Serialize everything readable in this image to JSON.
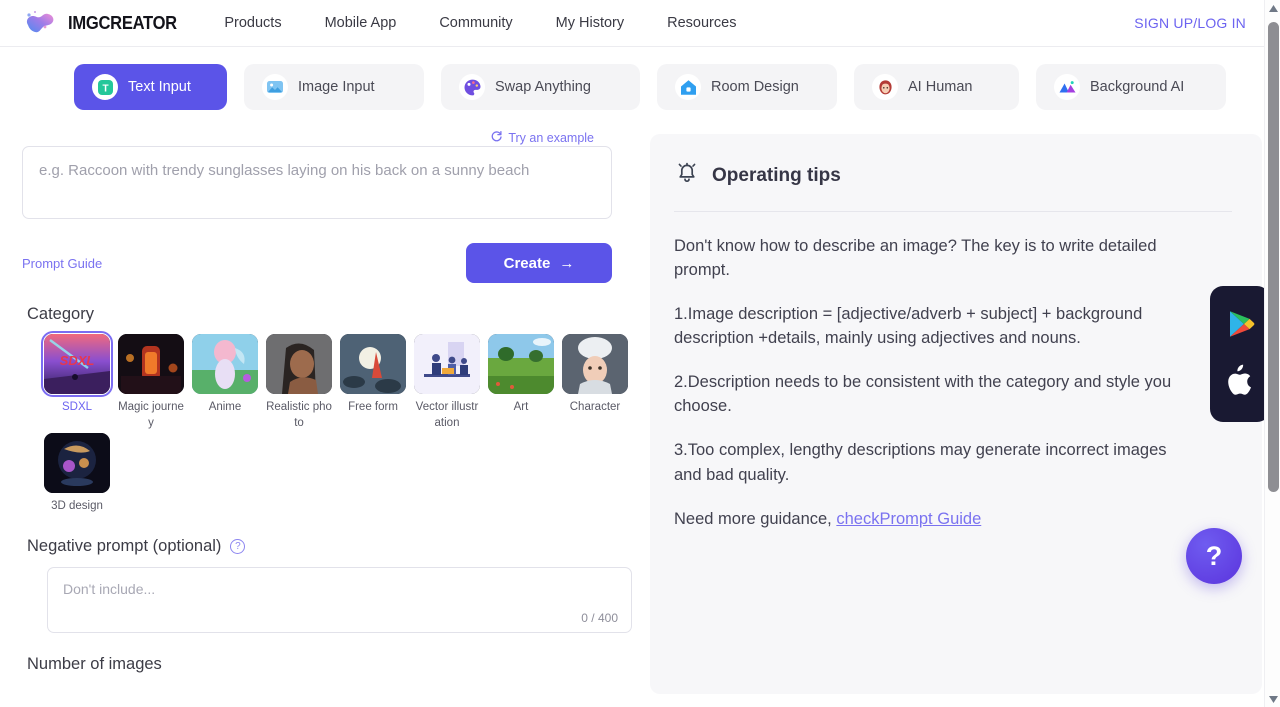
{
  "header": {
    "brand": "IMGCREATOR",
    "logo_colors": {
      "from": "#5b8dea",
      "to": "#e98fd8"
    },
    "nav": [
      {
        "label": "Products"
      },
      {
        "label": "Mobile App"
      },
      {
        "label": "Community"
      },
      {
        "label": "My History"
      },
      {
        "label": "Resources"
      }
    ],
    "auth_label": "SIGN UP/LOG IN",
    "auth_color": "#6c63f0"
  },
  "tabs": [
    {
      "label": "Text Input",
      "icon": "text-t-icon",
      "active": true
    },
    {
      "label": "Image Input",
      "icon": "picture-icon",
      "active": false
    },
    {
      "label": "Swap Anything",
      "icon": "palette-icon",
      "active": false
    },
    {
      "label": "Room Design",
      "icon": "house-icon",
      "active": false
    },
    {
      "label": "AI Human",
      "icon": "woman-face-icon",
      "active": false
    },
    {
      "label": "Background AI",
      "icon": "mountain-icon",
      "active": false
    }
  ],
  "prompt": {
    "try_example_label": "Try an example",
    "try_example_icon": "refresh-icon",
    "placeholder": "e.g. Raccoon with trendy sunglasses laying on his back on a sunny beach",
    "value": "",
    "guide_label": "Prompt Guide",
    "create_label": "Create",
    "create_arrow": "→"
  },
  "category": {
    "title": "Category",
    "items": [
      {
        "label": "SDXL",
        "selected": true
      },
      {
        "label": "Magic journey",
        "selected": false
      },
      {
        "label": "Anime",
        "selected": false
      },
      {
        "label": "Realistic photo",
        "selected": false
      },
      {
        "label": "Free form",
        "selected": false
      },
      {
        "label": "Vector illustration",
        "selected": false
      },
      {
        "label": "Art",
        "selected": false
      },
      {
        "label": "Character",
        "selected": false
      },
      {
        "label": "3D design",
        "selected": false
      }
    ]
  },
  "negative": {
    "title": "Negative prompt (optional)",
    "help_icon": "question-circle-icon",
    "placeholder": "Don't include...",
    "value": "",
    "counter": "0 / 400"
  },
  "number_of_images": {
    "title": "Number of images"
  },
  "tips": {
    "icon": "bell-icon",
    "title": "Operating tips",
    "paragraphs": [
      "Don't know how to describe an image? The key is to write detailed prompt.",
      "1.Image description = [adjective/adverb + subject] + background description +details, mainly using adjectives and nouns.",
      "2.Description needs to be consistent with the category and style you choose.",
      "3.Too complex, lengthy descriptions may generate incorrect images and bad quality."
    ],
    "footer_text": "Need more guidance, ",
    "footer_link": "checkPrompt Guide"
  },
  "app_dock": {
    "google_play_icon": "google-play-icon",
    "apple_icon": "apple-icon"
  },
  "help_fab": {
    "label": "?"
  },
  "scrollbar": {
    "up_icon": "scroll-up-arrow",
    "down_icon": "scroll-down-arrow"
  }
}
